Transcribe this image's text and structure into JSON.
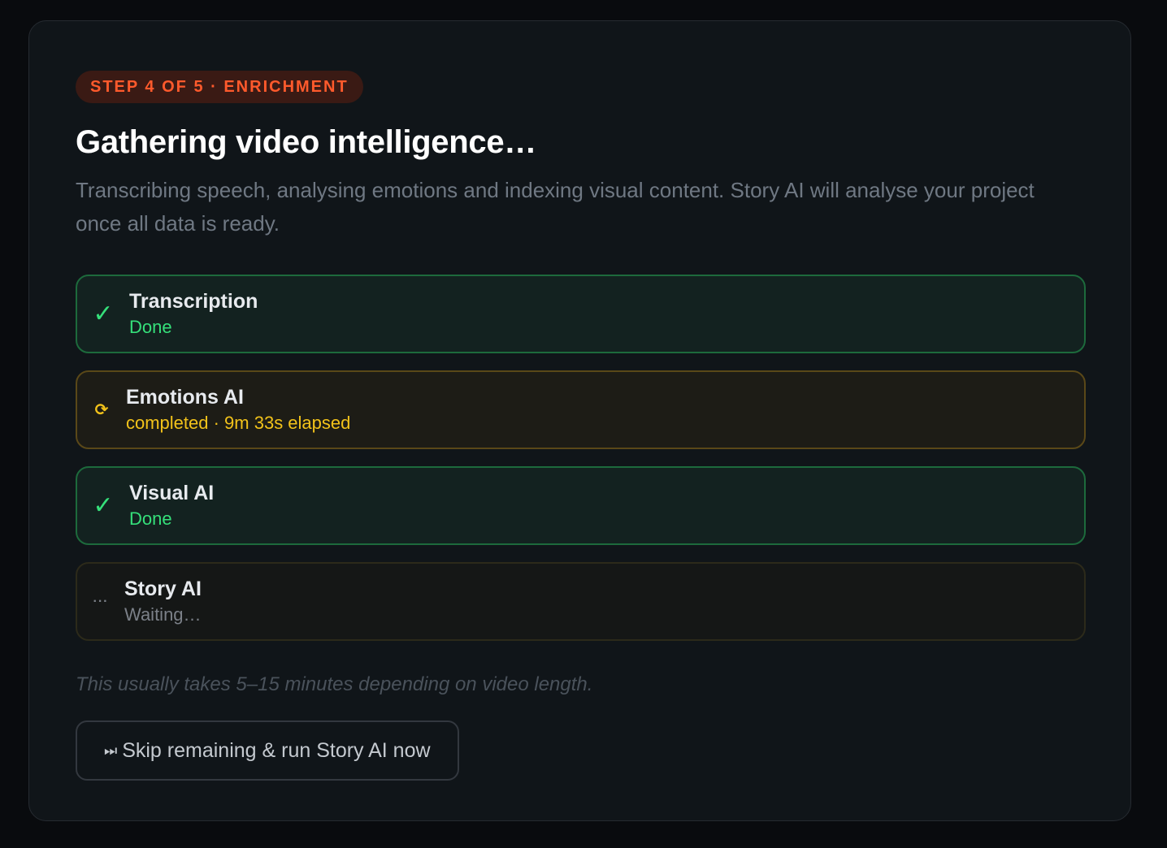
{
  "step_badge": "STEP 4 OF 5 · ENRICHMENT",
  "title": "Gathering video intelligence…",
  "description": "Transcribing speech, analysing emotions and indexing visual content. Story AI will analyse your project once all data is ready.",
  "tasks": [
    {
      "name": "Transcription",
      "status": "Done",
      "icon": "check-icon",
      "icon_glyph": "✓",
      "state": "done"
    },
    {
      "name": "Emotions AI",
      "status": "completed · 9m 33s elapsed",
      "icon": "refresh-icon",
      "icon_glyph": "⟳",
      "state": "running"
    },
    {
      "name": "Visual AI",
      "status": "Done",
      "icon": "check-icon",
      "icon_glyph": "✓",
      "state": "done"
    },
    {
      "name": "Story AI",
      "status": "Waiting…",
      "icon": "ellipsis-icon",
      "icon_glyph": "···",
      "state": "waiting"
    }
  ],
  "note": "This usually takes 5–15 minutes depending on video length.",
  "skip_button": {
    "icon": "skip-forward-icon",
    "icon_glyph": "⏭",
    "label": "Skip remaining & run Story AI now"
  },
  "colors": {
    "accent": "#ff5a2c",
    "done": "#35e07a",
    "running": "#f2c21a",
    "waiting": "#7b8088"
  }
}
